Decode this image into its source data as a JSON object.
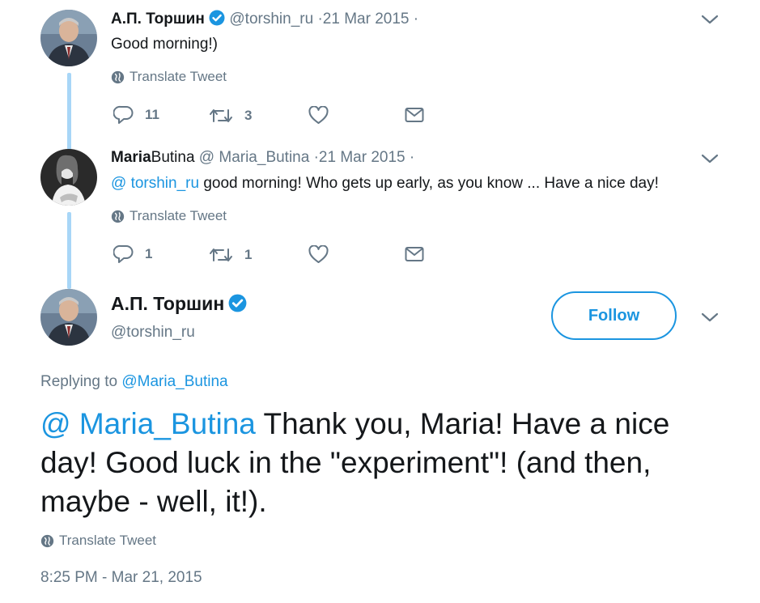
{
  "tweet1": {
    "display_name": "А.П. Торшин",
    "handle": "@torshin_ru",
    "date": "·21 Mar 2015",
    "dot": "·",
    "text": "Good morning!)",
    "translate": "Translate Tweet",
    "reply_count": "11",
    "retweet_count": "3"
  },
  "tweet2": {
    "display_name_bold": "Maria",
    "display_name_rest": "Butina",
    "handle": "@ Maria_Butina",
    "date": "·21 Mar 2015",
    "dot": "·",
    "mention": "@ torshin_ru",
    "text": " good morning! Who gets up early, as you know ... Have a nice day!",
    "translate": "Translate Tweet",
    "reply_count": "1",
    "retweet_count": "1"
  },
  "main_tweet": {
    "display_name": "А.П. Торшин",
    "handle": "@torshin_ru",
    "follow_label": "Follow",
    "replying_prefix": "Replying to ",
    "replying_to": "@Maria_Butina",
    "mention": "@ Maria_Butina",
    "text": " Thank you, Maria! Have a nice day! Good luck in the \"experiment\"! (and then, maybe - well, it!).",
    "translate": "Translate Tweet",
    "timestamp": "8:25 PM - Mar 21, 2015"
  },
  "icons": [
    "caret-down-icon",
    "verified-badge-icon",
    "globe-icon",
    "reply-icon",
    "retweet-icon",
    "like-icon",
    "direct-message-icon"
  ],
  "colors": {
    "accent": "#1b95e0",
    "thread_line": "#a8d6f7",
    "muted": "#657786"
  }
}
